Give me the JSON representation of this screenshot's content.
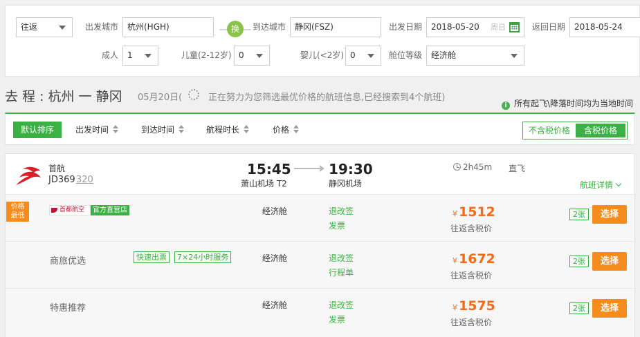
{
  "search": {
    "trip_type": "往返",
    "depart_city_label": "出发城市",
    "depart_city": "杭州(HGH)",
    "swap_label": "换",
    "arrive_city_label": "到达城市",
    "arrive_city": "静冈(FSZ)",
    "depart_date_label": "出发日期",
    "depart_date": "2018-05-20",
    "depart_weekday": "周日",
    "return_date_label": "返回日期",
    "return_date": "2018-05-24",
    "adult_label": "成人",
    "adult_count": "1",
    "child_label": "儿童(2-12岁)",
    "child_count": "0",
    "infant_label": "婴儿(<2岁)",
    "infant_count": "0",
    "cabin_label": "舱位等级",
    "cabin_value": "经济舱"
  },
  "route": {
    "title": "去 程 : 杭州 一 静冈",
    "date": "05月20日(",
    "searching": "正在努力为您筛选最优价格的航班信息,已经搜索到4个航班)",
    "tz_note": "所有起飞\\降落时间均为当地时间",
    "info_icon": "i"
  },
  "sort": {
    "default": "默认排序",
    "items": [
      "出发时间",
      "到达时间",
      "航程时长",
      "价格"
    ],
    "tax_excluded": "不含税价格",
    "tax_included": "含税价格"
  },
  "colors": {
    "accent_green": "#3cb044",
    "accent_orange": "#f58c1c",
    "price_orange": "#f26b1b"
  },
  "flight": {
    "airline": "首航",
    "flight_no": "JD369",
    "plane_type": "320",
    "dep_time": "15:45",
    "dep_airport": "萧山机场 T2",
    "arr_time": "19:30",
    "arr_airport": "静冈机场",
    "duration": "2h45m",
    "stops": "直飞",
    "details_link": "航班详情",
    "lowest_badge_1": "价格",
    "lowest_badge_2": "最低",
    "ca_brand_logo": "首都航空",
    "ca_brand_store": "官方直营店",
    "offers": [
      {
        "product": "",
        "tags": [],
        "cabin": "经济舱",
        "refund": "退改签",
        "doc": "发票",
        "currency": "¥",
        "price": "1512",
        "price_note": "往返含税价",
        "seats": "2张",
        "button": "选择"
      },
      {
        "product": "商旅优选",
        "tags": [
          "快速出票",
          "7×24小时服务"
        ],
        "cabin": "经济舱",
        "refund": "退改签",
        "doc": "行程单",
        "currency": "¥",
        "price": "1672",
        "price_note": "往返含税价",
        "seats": "2张",
        "button": "选择"
      },
      {
        "product": "特惠推荐",
        "tags": [],
        "cabin": "经济舱",
        "refund": "退改签",
        "doc": "发票",
        "currency": "¥",
        "price": "1575",
        "price_note": "往返含税价",
        "seats": "2张",
        "button": "选择"
      }
    ]
  }
}
